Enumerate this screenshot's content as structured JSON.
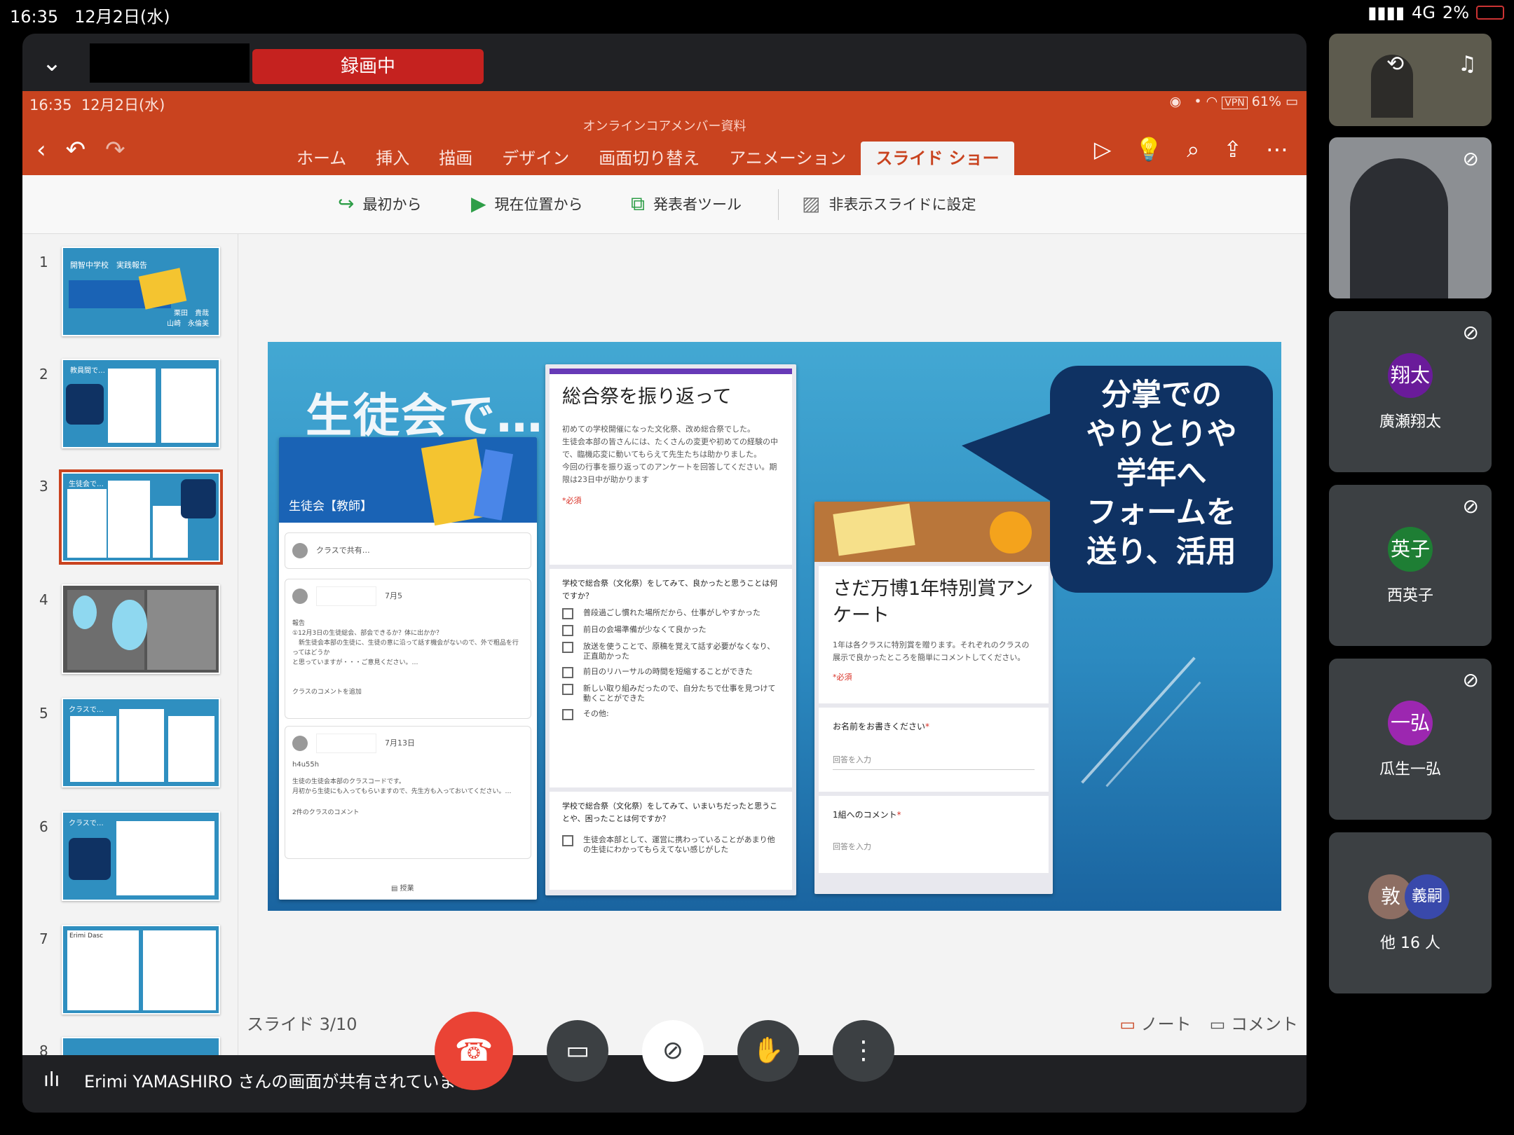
{
  "device_status": {
    "time": "16:35",
    "date": "12月2日(水)",
    "network": "4G",
    "battery": "2%"
  },
  "meet": {
    "recording_label": "録画中",
    "sharing_banner": "Erimi YAMASHIRO さんの画面が共有されています"
  },
  "ppt": {
    "status_time": "16:35",
    "status_date": "12月2日(水)",
    "status_battery": "61%",
    "status_vpn": "VPN",
    "title": "オンラインコアメンバー資料",
    "tabs": [
      "ホーム",
      "挿入",
      "描画",
      "デザイン",
      "画面切り替え",
      "アニメーション",
      "スライド ショー"
    ],
    "active_tab": "スライド ショー",
    "ribbon": [
      "最初から",
      "現在位置から",
      "発表者ツール",
      "非表示スライドに設定"
    ],
    "slide_counter": "スライド 3/10",
    "note_label": "ノート",
    "comment_label": "コメント",
    "thumb_numbers": [
      "1",
      "2",
      "3",
      "4",
      "5",
      "6",
      "7",
      "8"
    ],
    "thumb1_title": "開智中学校　実践報告",
    "thumb1_names": "栗田　貴哉\n山崎　永倫美",
    "thumb2_title": "教員間で…",
    "thumb3_title": "生徒会で…",
    "thumb5_title": "クラスで…",
    "thumb6_title": "クラスで…",
    "thumb7_title": "Erimi Dasc"
  },
  "slide": {
    "title": "生徒会で…",
    "bubble": "分掌での\nやりとりや\n学年へ\nフォームを\n送り、活用",
    "classroom": {
      "banner": "生徒会【教師】",
      "share_placeholder": "クラスで共有…",
      "post1_date": "7月5",
      "post1_body": "報告\n①12月3日の生徒総会、部会できるか？体に出かか？\n　新生徒会本部の生徒に、生徒の意に沿って話す機会がないので、外で粗品を行ってはどうか\nと思っていますが・・・ご意見ください。…",
      "post1_comment": "クラスのコメントを追加",
      "post2_date": "7月13日",
      "post2_code": "h4u55h",
      "post2_body": "生徒の生徒会本部のクラスコードです。\n月初から生徒にも入ってもらいますので、先生方も入っておいてください。…",
      "post2_comment": "2件のクラスのコメント",
      "footer_label": "授業"
    },
    "form1": {
      "title": "総合祭を振り返って",
      "desc": "初めての学校開催になった文化祭、改め総合祭でした。\n生徒会本部の皆さんには、たくさんの変更や初めての経験の中で、臨機応変に動いてもらえて先生たちは助かりました。\n今回の行事を振り返ってのアンケートを回答してください。期限は23日中が助かります",
      "required": "*必須",
      "q1": "学校で総合祭（文化祭）をしてみて、良かったと思うことは何ですか？",
      "options": [
        "普段過ごし慣れた場所だから、仕事がしやすかった",
        "前日の会場準備が少なくて良かった",
        "放送を使うことで、原稿を覚えて話す必要がなくなり、正直助かった",
        "前日のリハーサルの時間を短縮することができた",
        "新しい取り組みだったので、自分たちで仕事を見つけて動くことができた",
        "その他:"
      ],
      "q2": "学校で総合祭（文化祭）をしてみて、いまいちだったと思うことや、困ったことは何ですか？",
      "q2_option": "生徒会本部として、運営に携わっていることがあまり他の生徒にわかってもらえてない感じがした"
    },
    "form2": {
      "title": "さだ万博1年特別賞アンケート",
      "desc": "1年は各クラスに特別賞を贈ります。それぞれのクラスの展示で良かったところを簡単にコメントしてください。",
      "required": "*必須",
      "q1": "お名前をお書きください",
      "q1_placeholder": "回答を入力",
      "q2": "1組へのコメント",
      "q2_placeholder": "回答を入力"
    }
  },
  "participants": [
    {
      "name": "廣瀬翔太",
      "initial": "翔太",
      "color": "#6a1b9a"
    },
    {
      "name": "西英子",
      "initial": "英子",
      "color": "#1e7e34"
    },
    {
      "name": "瓜生一弘",
      "initial": "一弘",
      "color": "#9c27b0"
    }
  ],
  "others": {
    "label": "他 16 人",
    "initial1": "敦",
    "initial2": "義嗣",
    "color1": "#8d6e63",
    "color2": "#3949ab"
  }
}
